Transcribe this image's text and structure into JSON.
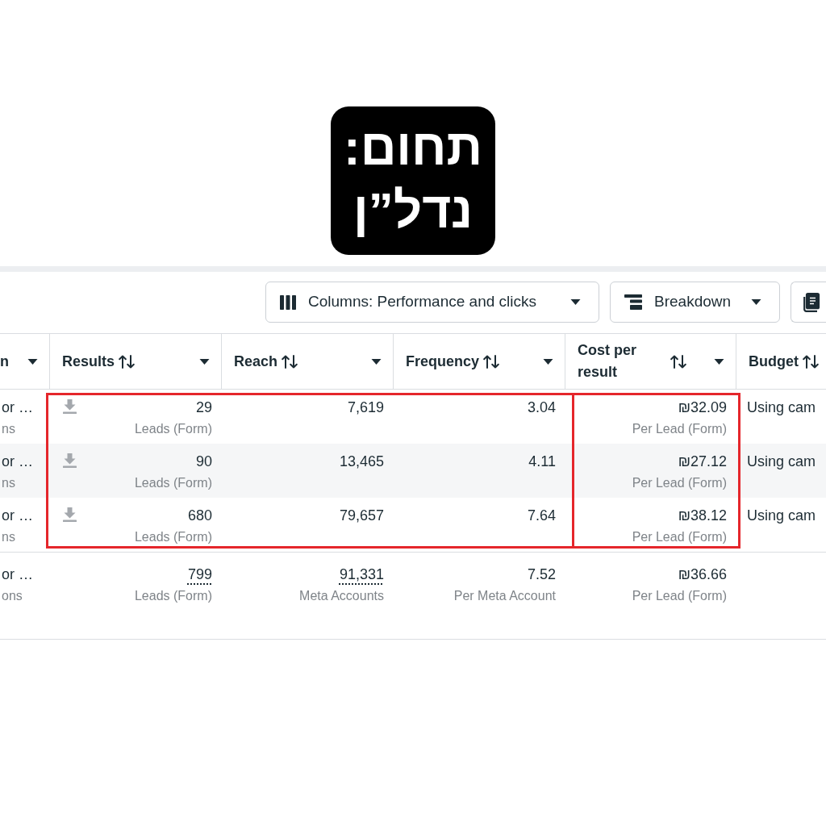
{
  "badge": {
    "lines": [
      "תחום:",
      "נדל”ן"
    ]
  },
  "toolbar": {
    "buttons": [
      {
        "kind": "columns",
        "label": "Columns: Performance and clicks",
        "dropdown": true
      },
      {
        "kind": "breakdown",
        "label": "Breakdown",
        "dropdown": true
      },
      {
        "kind": "notebook",
        "dropdown": false
      }
    ]
  },
  "table": {
    "column_groups": [
      {
        "highlighted": false,
        "columns": [
          {
            "label": "n",
            "sortable": false,
            "menu": true
          }
        ]
      },
      {
        "highlighted": true,
        "columns": [
          {
            "label": "Results",
            "sortable": true,
            "menu": true
          },
          {
            "label": "Reach",
            "sortable": true,
            "menu": true
          },
          {
            "label": "Frequency",
            "sortable": true,
            "menu": true
          }
        ]
      },
      {
        "highlighted": true,
        "columns": [
          {
            "label": "Cost per result",
            "sortable": true,
            "menu": true
          }
        ]
      },
      {
        "highlighted": false,
        "columns": [
          {
            "label": "Budget",
            "sortable": true,
            "menu": false
          }
        ]
      }
    ],
    "rows": [
      {
        "kind": "item",
        "cells": [
          {
            "text": "or …",
            "sub": "ns"
          },
          {
            "text": "29",
            "sub": "Leads (Form)",
            "download": true
          },
          {
            "text": "7,619"
          },
          {
            "text": "3.04"
          },
          {
            "text": "₪32.09",
            "sub": "Per Lead (Form)"
          },
          {
            "text": "Using cam"
          }
        ]
      },
      {
        "kind": "item",
        "cells": [
          {
            "text": "or …",
            "sub": "ns"
          },
          {
            "text": "90",
            "sub": "Leads (Form)",
            "download": true
          },
          {
            "text": "13,465"
          },
          {
            "text": "4.11"
          },
          {
            "text": "₪27.12",
            "sub": "Per Lead (Form)"
          },
          {
            "text": "Using cam"
          }
        ]
      },
      {
        "kind": "item",
        "cells": [
          {
            "text": "or …",
            "sub": "ns"
          },
          {
            "text": "680",
            "sub": "Leads (Form)",
            "download": true
          },
          {
            "text": "79,657"
          },
          {
            "text": "7.64"
          },
          {
            "text": "₪38.12",
            "sub": "Per Lead (Form)"
          },
          {
            "text": "Using cam"
          }
        ]
      },
      {
        "kind": "total",
        "cells": [
          {
            "text": "or …",
            "sub": "ons"
          },
          {
            "text": "799",
            "sub": "Leads (Form)",
            "underlined": true
          },
          {
            "text": "91,331",
            "sub": "Meta Accounts",
            "underlined": true
          },
          {
            "text": "7.52",
            "sub": "Per Meta Account",
            "underlined": false
          },
          {
            "text": "₪36.66",
            "sub": "Per Lead (Form)",
            "underlined": false
          }
        ]
      }
    ]
  }
}
